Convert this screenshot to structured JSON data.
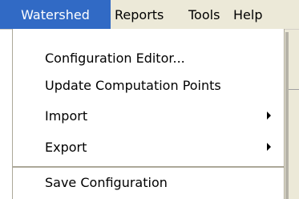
{
  "menubar": {
    "items": [
      {
        "label": "Watershed",
        "active": true
      },
      {
        "label": "Reports",
        "active": false
      },
      {
        "label": "Tools",
        "active": false
      },
      {
        "label": "Help",
        "active": false
      }
    ]
  },
  "dropdown": {
    "items": [
      {
        "label": "Configuration Editor...",
        "submenu": false
      },
      {
        "label": "Update Computation Points",
        "submenu": false
      },
      {
        "label": "Import",
        "submenu": true
      },
      {
        "label": "Export",
        "submenu": true
      },
      {
        "label": "Save Configuration",
        "submenu": false
      }
    ]
  },
  "colors": {
    "highlight": "#316ac5",
    "menubar_bg": "#ece9d8",
    "menu_bg": "#ffffff",
    "separator": "#aca899"
  },
  "icons": {
    "submenu_arrow": "chevron-right-icon"
  }
}
